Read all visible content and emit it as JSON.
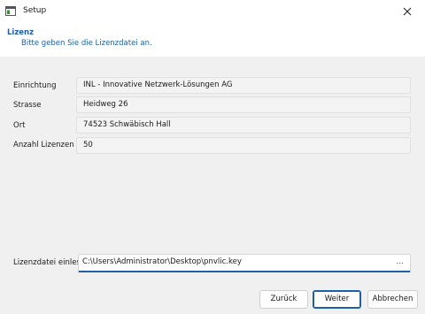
{
  "window": {
    "title": "Setup"
  },
  "header": {
    "title": "Lizenz",
    "subtitle": "Bitte geben Sie die Lizenzdatei an."
  },
  "fields": [
    {
      "label": "Einrichtung",
      "value": "INL - Innovative Netzwerk-Lösungen AG"
    },
    {
      "label": "Strasse",
      "value": "Heidweg 26"
    },
    {
      "label": "Ort",
      "value": "74523 Schwäbisch Hall"
    },
    {
      "label": "Anzahl Lizenzen",
      "value": "50"
    }
  ],
  "license_file": {
    "label": "Lizenzdatei einlesen",
    "value": "C:\\Users\\Administrator\\Desktop\\pnvlic.key",
    "browse_label": "..."
  },
  "buttons": {
    "back": "Zurück",
    "next": "Weiter",
    "cancel": "Abbrechen"
  },
  "icons": {
    "app": "setup-app-icon",
    "close": "close-icon"
  },
  "colors": {
    "accent": "#1f5fa8"
  }
}
